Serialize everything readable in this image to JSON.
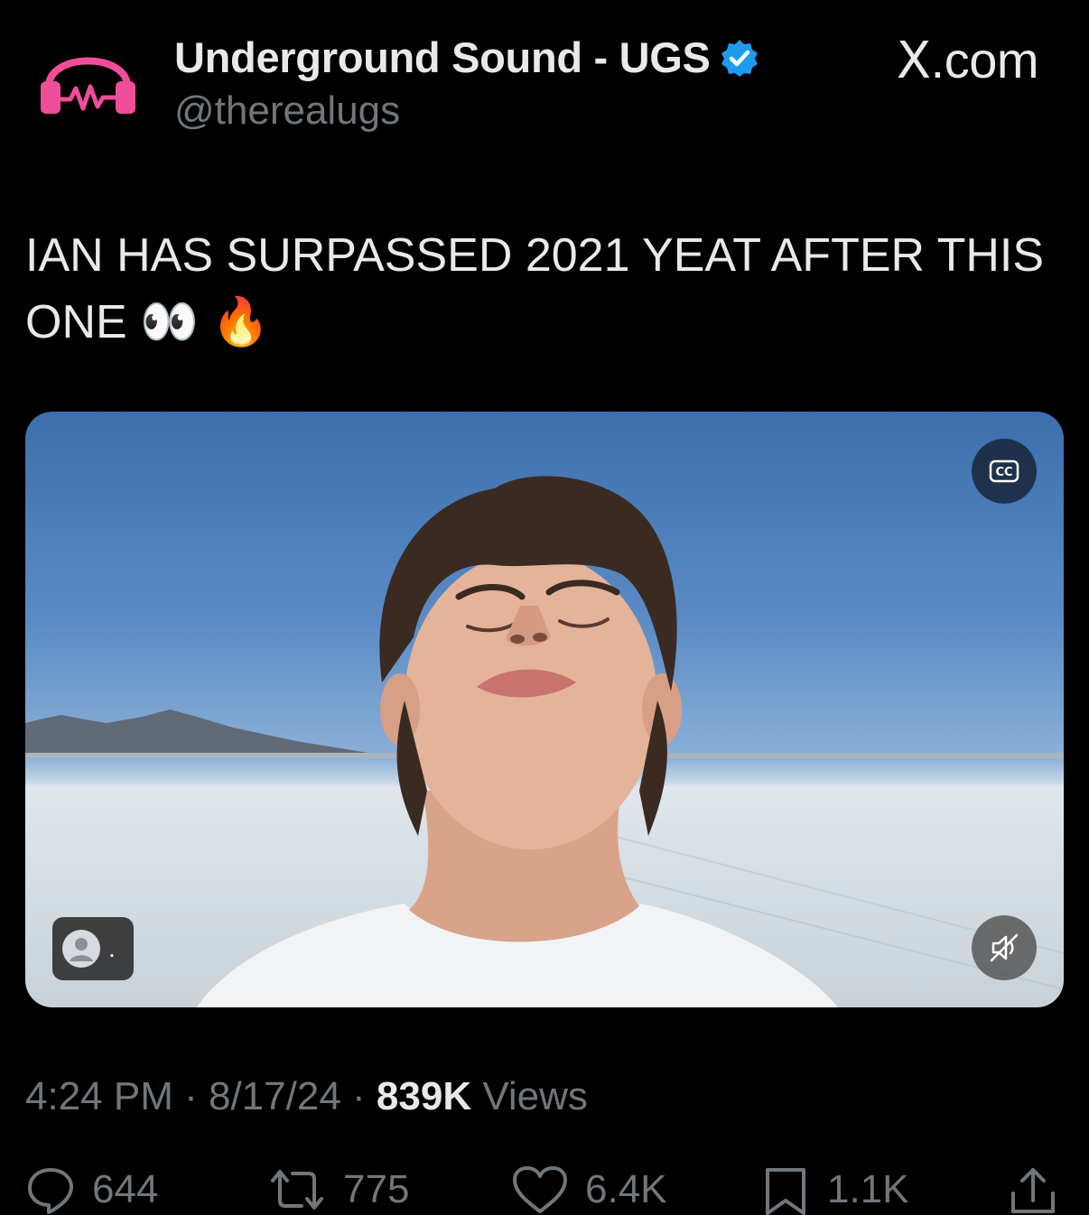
{
  "header": {
    "display_name": "Underground Sound - UGS",
    "handle": "@therealugs",
    "brand": "X.com",
    "brand_x": "X",
    "brand_suffix": ".com",
    "avatar_icon": "headphones-logo-icon",
    "verified_icon": "verified-badge-icon",
    "accent": "#f04d9b",
    "verified_color": "#1d9bf0"
  },
  "tweet": {
    "text_line1": "IAN HAS SURPASSED 2021 YEAT AFTER THIS",
    "text_line2": "ONE 👀 🔥"
  },
  "media": {
    "cc_label": "CC",
    "cc_icon": "closed-captions-icon",
    "mute_icon": "muted-speaker-icon",
    "user_chip_icon": "person-icon",
    "user_chip_dot": "."
  },
  "meta": {
    "time": "4:24 PM",
    "sep1": " · ",
    "date": "8/17/24",
    "sep2": " · ",
    "views_count": "839K",
    "views_label": " Views"
  },
  "actions": {
    "replies": "644",
    "reposts": "775",
    "likes": "6.4K",
    "bookmarks": "1.1K",
    "reply_icon": "reply-icon",
    "repost_icon": "repost-icon",
    "like_icon": "heart-icon",
    "bookmark_icon": "bookmark-icon",
    "share_icon": "share-icon"
  }
}
